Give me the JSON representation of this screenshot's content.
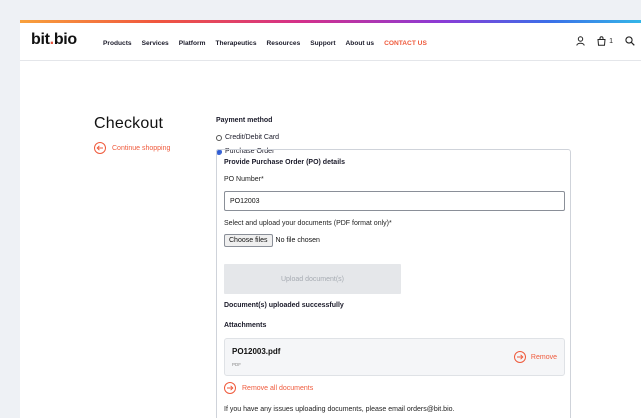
{
  "brand": {
    "logo_text": "bit.bio",
    "logo_part1": "bit",
    "logo_dot": ".",
    "logo_part2": "bio",
    "accent_color": "#ef5a3c"
  },
  "nav": {
    "links": [
      "Products",
      "Services",
      "Platform",
      "Therapeutics",
      "Resources",
      "Support",
      "About us"
    ],
    "contact_label": "CONTACT US",
    "cart_count": "1",
    "icons": [
      "user-icon",
      "cart-icon",
      "search-icon"
    ]
  },
  "checkout": {
    "title": "Checkout",
    "continue_label": "Continue shopping"
  },
  "payment": {
    "title": "Payment method",
    "options": [
      {
        "label": "Credit/Debit Card",
        "selected": false
      },
      {
        "label": "Purchase Order",
        "selected": true
      }
    ]
  },
  "po": {
    "heading": "Provide Purchase Order (PO) details",
    "number_label": "PO Number*",
    "number_value": "PO12003",
    "upload_hint": "Select and upload your documents (PDF format only)*",
    "choose_files_label": "Choose files",
    "no_file_label": "No file chosen",
    "upload_button_label": "Upload document(s)",
    "success_message": "Document(s) uploaded successfully",
    "attachments_title": "Attachments",
    "attachments": [
      {
        "name": "PO12003.pdf",
        "type": "PDF",
        "remove_label": "Remove"
      }
    ],
    "remove_all_label": "Remove all documents",
    "help_text": "If you have any issues uploading documents, please email orders@bit.bio."
  }
}
